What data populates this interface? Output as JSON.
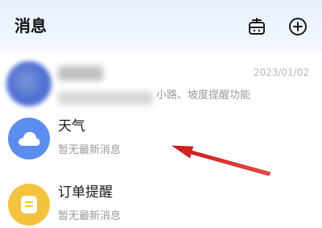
{
  "header": {
    "title": "消息",
    "icons": [
      "robot-icon",
      "add-circle-icon"
    ]
  },
  "messages": [
    {
      "name": "",
      "preview_visible": "小路、坡度提醒功能",
      "date": "2023/01/02",
      "avatar_icon": "blurred-avatar"
    },
    {
      "name": "天气",
      "preview": "暂无最新消息",
      "avatar_icon": "cloud-icon",
      "avatar_color": "#5b8cf0"
    },
    {
      "name": "订单提醒",
      "preview": "暂无最新消息",
      "avatar_icon": "document-icon",
      "avatar_color": "#f5c23c"
    }
  ],
  "annotation": {
    "arrow_color": "#e02020",
    "arrow_icon": "red-arrow-icon"
  }
}
